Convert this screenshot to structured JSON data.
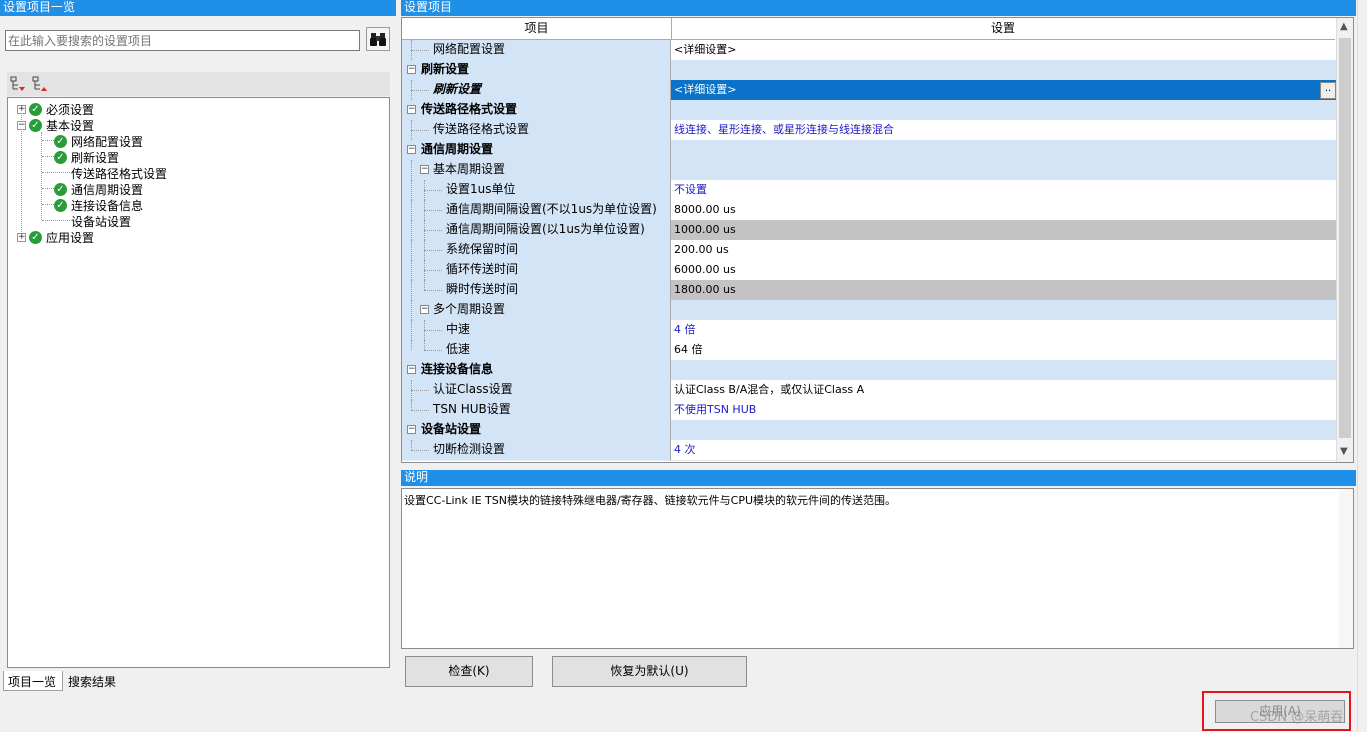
{
  "left_panel": {
    "title": "设置项目一览",
    "search_placeholder": "在此输入要搜索的设置项目",
    "tree": [
      {
        "label": "必须设置"
      },
      {
        "label": "基本设置"
      },
      {
        "label": "网络配置设置"
      },
      {
        "label": "刷新设置"
      },
      {
        "label": "传送路径格式设置"
      },
      {
        "label": "通信周期设置"
      },
      {
        "label": "连接设备信息"
      },
      {
        "label": "设备站设置"
      },
      {
        "label": "应用设置"
      }
    ],
    "tabs": [
      "项目一览",
      "搜索结果"
    ]
  },
  "settings_grid": {
    "title": "设置项目",
    "col_item": "项目",
    "col_setting": "设置",
    "rows": [
      {
        "label": "网络配置设置",
        "value": "<详细设置>"
      },
      {
        "label": "刷新设置",
        "value": ""
      },
      {
        "label": "刷新设置",
        "value": "<详细设置>",
        "ellipsis": ".."
      },
      {
        "label": "传送路径格式设置",
        "value": ""
      },
      {
        "label": "传送路径格式设置",
        "value": "线连接、星形连接、或星形连接与线连接混合"
      },
      {
        "label": "通信周期设置",
        "value": ""
      },
      {
        "label": "基本周期设置",
        "value": ""
      },
      {
        "label": "设置1us单位",
        "value": "不设置"
      },
      {
        "label": "通信周期间隔设置(不以1us为单位设置)",
        "value": "8000.00 us"
      },
      {
        "label": "通信周期间隔设置(以1us为单位设置)",
        "value": "1000.00 us"
      },
      {
        "label": "系统保留时间",
        "value": "200.00 us"
      },
      {
        "label": "循环传送时间",
        "value": "6000.00 us"
      },
      {
        "label": "瞬时传送时间",
        "value": "1800.00 us"
      },
      {
        "label": "多个周期设置",
        "value": ""
      },
      {
        "label": "中速",
        "value": "4 倍"
      },
      {
        "label": "低速",
        "value": "64 倍"
      },
      {
        "label": "连接设备信息",
        "value": ""
      },
      {
        "label": "认证Class设置",
        "value": "认证Class B/A混合，或仅认证Class A"
      },
      {
        "label": "TSN HUB设置",
        "value": "不使用TSN HUB"
      },
      {
        "label": "设备站设置",
        "value": ""
      },
      {
        "label": "切断检测设置",
        "value": "4 次"
      }
    ]
  },
  "description": {
    "title": "说明",
    "text": "设置CC-Link IE TSN模块的链接特殊继电器/寄存器、链接软元件与CPU模块的软元件间的传送范围。"
  },
  "buttons": {
    "check": "检查(K)",
    "restore_default": "恢复为默认(U)",
    "apply": "应用(A)"
  },
  "watermark": "CSDN @呆萌吞",
  "colors": {
    "header_blue": "#1f8fe8",
    "category_row": "#d3e4f7",
    "selected_row": "#0a72c8",
    "greyed_value": "#c3c3c3",
    "check_green": "#2a9d3a",
    "highlight_red": "#e0161b"
  },
  "icons": [
    "binoculars-icon",
    "expand-all-icon",
    "collapse-all-icon",
    "check-circle-icon",
    "ellipsis-icon"
  ]
}
